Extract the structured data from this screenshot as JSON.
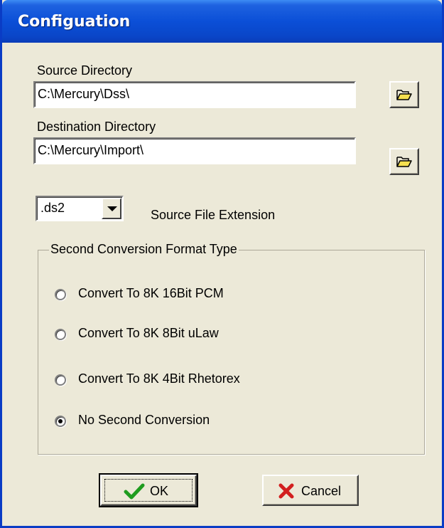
{
  "window": {
    "title": "Configuation"
  },
  "source": {
    "label": "Source Directory",
    "value": "C:\\Mercury\\Dss\\",
    "browse_icon": "open-folder-icon"
  },
  "destination": {
    "label": "Destination Directory",
    "value": "C:\\Mercury\\Import\\",
    "browse_icon": "open-folder-icon"
  },
  "extension": {
    "selected": ".ds2",
    "label": "Source File Extension"
  },
  "conversion": {
    "group_label": "Second Conversion Format Type",
    "options": [
      {
        "label": "Convert To 8K 16Bit PCM",
        "checked": false
      },
      {
        "label": "Convert To 8K 8Bit uLaw",
        "checked": false
      },
      {
        "label": "Convert To 8K 4Bit Rhetorex",
        "checked": false
      },
      {
        "label": "No Second Conversion",
        "checked": true
      }
    ]
  },
  "buttons": {
    "ok_label": "OK",
    "ok_icon": "green-checkmark-icon",
    "cancel_label": "Cancel",
    "cancel_icon": "red-x-icon"
  },
  "colors": {
    "titlebar": "#0a4fd7",
    "dialog_bg": "#ece9d8",
    "folder_icon": "#f5e050",
    "ok_check": "#1f9c1f",
    "cancel_x": "#d21f1f"
  }
}
